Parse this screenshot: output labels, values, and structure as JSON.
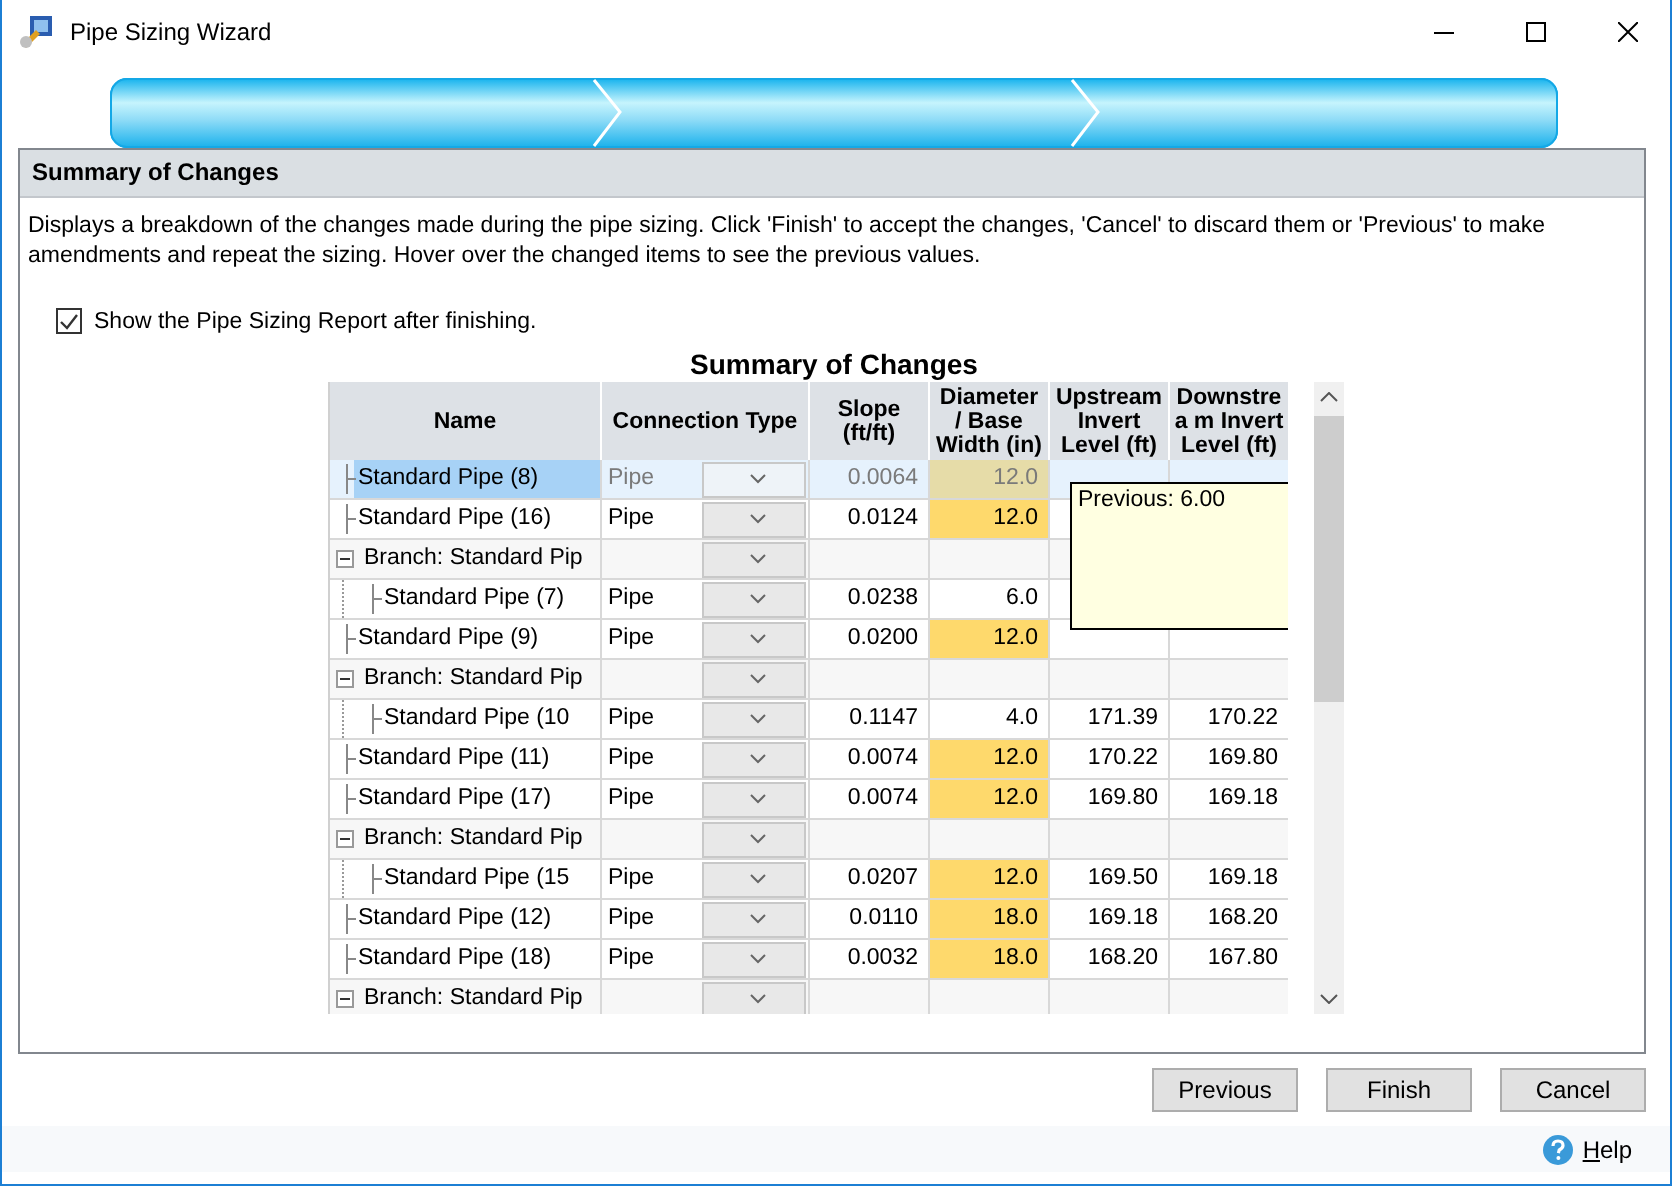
{
  "window": {
    "title": "Pipe Sizing Wizard"
  },
  "wizard_progress": {
    "level": 1
  },
  "panel": {
    "title": "Summary of Changes",
    "description": "Displays a breakdown of the changes made during the pipe sizing. Click 'Finish' to accept the changes, 'Cancel' to discard them or 'Previous' to make amendments and repeat the sizing. Hover over the changed items to see the previous values."
  },
  "show_report": {
    "label": "Show the Pipe Sizing Report after finishing.",
    "checked": true
  },
  "table": {
    "title": "Summary of Changes",
    "columns": [
      "Name",
      "Connection Type",
      "Slope (ft/ft)",
      "Diameter / Base Width (in)",
      "Upstream Invert Level (ft)",
      "Downstrea m Invert Level (ft)"
    ],
    "rows": [
      {
        "kind": "pipe",
        "name": "Standard Pipe (8)",
        "connection_type": "Pipe",
        "slope": "0.0064",
        "diameter": "12.0",
        "diameter_changed": true,
        "selected": true
      },
      {
        "kind": "pipe",
        "name": "Standard Pipe (16)",
        "connection_type": "Pipe",
        "slope": "0.0124",
        "diameter": "12.0",
        "diameter_changed": true,
        "selected": false
      },
      {
        "kind": "branch",
        "name": "Branch: Standard Pip",
        "expanded": true,
        "selected": false,
        "children": [
          {
            "kind": "pipe",
            "name": "Standard Pipe (7)",
            "connection_type": "Pipe",
            "slope": "0.0238",
            "diameter": "6.0",
            "diameter_changed": false,
            "selected": false
          }
        ]
      },
      {
        "kind": "pipe",
        "name": "Standard Pipe (9)",
        "connection_type": "Pipe",
        "slope": "0.0200",
        "diameter": "12.0",
        "diameter_changed": true,
        "selected": false
      },
      {
        "kind": "branch",
        "name": "Branch: Standard Pip",
        "expanded": true,
        "selected": false,
        "children": [
          {
            "kind": "pipe",
            "name": "Standard Pipe (10",
            "connection_type": "Pipe",
            "slope": "0.1147",
            "diameter": "4.0",
            "diameter_changed": false,
            "upstream": "171.39",
            "downstream": "170.22",
            "selected": false
          }
        ]
      },
      {
        "kind": "pipe",
        "name": "Standard Pipe (11)",
        "connection_type": "Pipe",
        "slope": "0.0074",
        "diameter": "12.0",
        "diameter_changed": true,
        "upstream": "170.22",
        "downstream": "169.80",
        "selected": false
      },
      {
        "kind": "pipe",
        "name": "Standard Pipe (17)",
        "connection_type": "Pipe",
        "slope": "0.0074",
        "diameter": "12.0",
        "diameter_changed": true,
        "upstream": "169.80",
        "downstream": "169.18",
        "selected": false
      },
      {
        "kind": "branch",
        "name": "Branch: Standard Pip",
        "expanded": true,
        "selected": false,
        "children": [
          {
            "kind": "pipe",
            "name": "Standard Pipe (15",
            "connection_type": "Pipe",
            "slope": "0.0207",
            "diameter": "12.0",
            "diameter_changed": true,
            "upstream": "169.50",
            "downstream": "169.18",
            "selected": false
          }
        ]
      },
      {
        "kind": "pipe",
        "name": "Standard Pipe (12)",
        "connection_type": "Pipe",
        "slope": "0.0110",
        "diameter": "18.0",
        "diameter_changed": true,
        "upstream": "169.18",
        "downstream": "168.20",
        "selected": false
      },
      {
        "kind": "pipe",
        "name": "Standard Pipe (18)",
        "connection_type": "Pipe",
        "slope": "0.0032",
        "diameter": "18.0",
        "diameter_changed": true,
        "upstream": "168.20",
        "downstream": "167.80",
        "selected": false
      },
      {
        "kind": "branch",
        "name": "Branch: Standard Pip",
        "expanded": true,
        "selected": false
      }
    ]
  },
  "tooltip": {
    "text": "Previous: 6.00"
  },
  "buttons": [
    "Previous",
    "Finish",
    "Cancel"
  ],
  "help": {
    "label": "Help"
  }
}
